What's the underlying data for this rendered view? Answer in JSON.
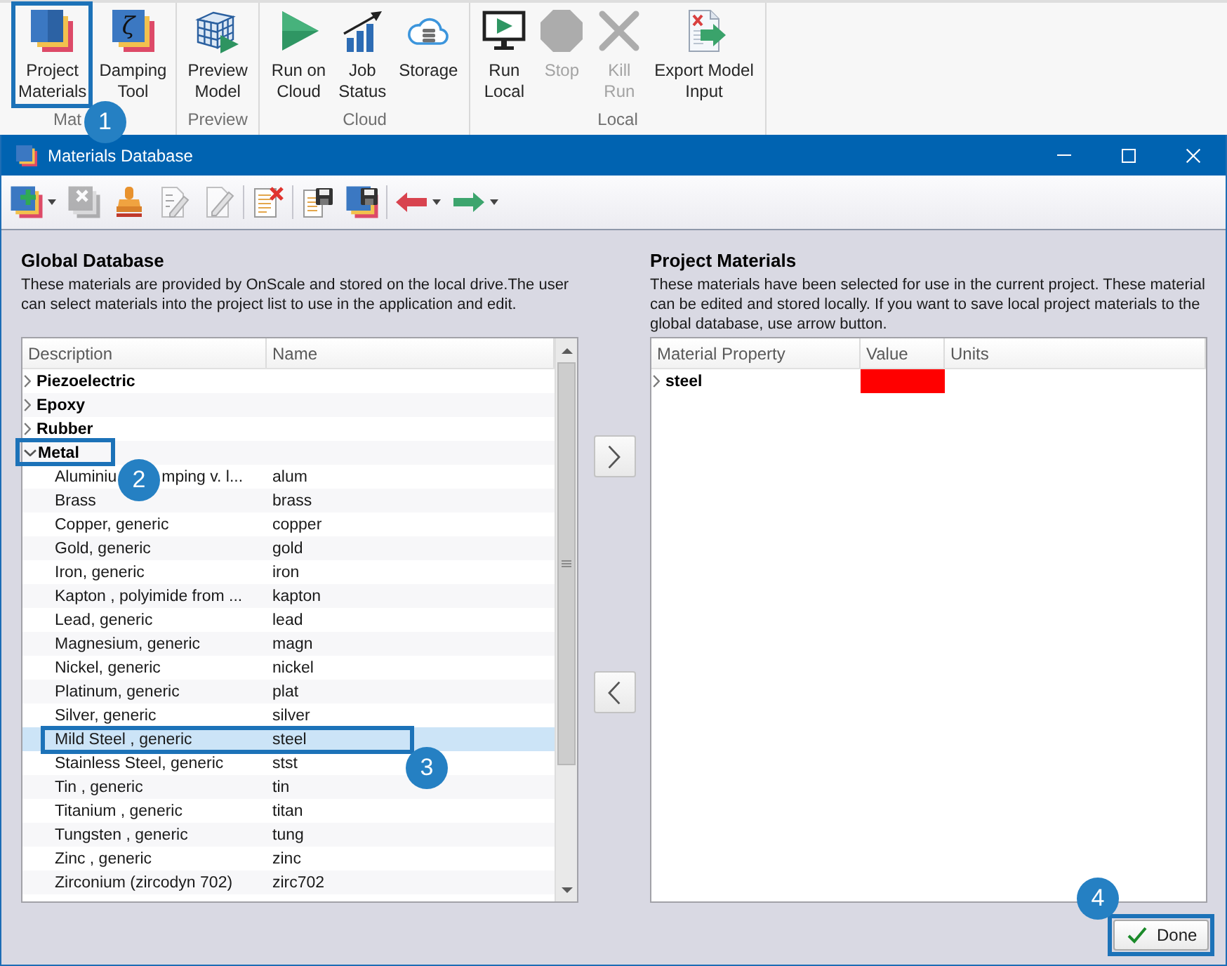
{
  "ribbon": {
    "groups": [
      {
        "label": "Mat",
        "buttons": [
          {
            "label": [
              "Project",
              "Materials"
            ],
            "disabled": false,
            "annotation": "1"
          },
          {
            "label": [
              "Damping",
              "Tool"
            ],
            "disabled": false,
            "icon_glyph": "ζ"
          }
        ]
      },
      {
        "label": "Preview",
        "buttons": [
          {
            "label": [
              "Preview",
              "Model"
            ],
            "disabled": false
          }
        ]
      },
      {
        "label": "Cloud",
        "buttons": [
          {
            "label": [
              "Run on",
              "Cloud"
            ],
            "disabled": false
          },
          {
            "label": [
              "Job",
              "Status"
            ],
            "disabled": false
          },
          {
            "label": [
              "Storage"
            ],
            "disabled": false
          }
        ]
      },
      {
        "label": "Local",
        "buttons": [
          {
            "label": [
              "Run",
              "Local"
            ],
            "disabled": false
          },
          {
            "label": [
              "Stop"
            ],
            "disabled": true
          },
          {
            "label": [
              "Kill",
              "Run"
            ],
            "disabled": true
          },
          {
            "label": [
              "Export Model",
              "Input"
            ],
            "disabled": false
          }
        ]
      }
    ]
  },
  "dialog": {
    "title": "Materials Database",
    "toolbar": [
      {
        "items": [
          {
            "disabled": false,
            "dropdown": true
          },
          {
            "disabled": true,
            "dropdown": false
          },
          {
            "disabled": false,
            "dropdown": false
          },
          {
            "disabled": true,
            "dropdown": false
          },
          {
            "disabled": true,
            "dropdown": false
          }
        ]
      },
      {
        "items": [
          {
            "disabled": false,
            "dropdown": false
          }
        ]
      },
      {
        "items": [
          {
            "disabled": false,
            "dropdown": false
          },
          {
            "disabled": false,
            "dropdown": false
          }
        ]
      },
      {
        "items": [
          {
            "disabled": false,
            "dropdown": true
          },
          {
            "disabled": false,
            "dropdown": true
          }
        ]
      }
    ]
  },
  "global_database": {
    "heading": "Global Database",
    "description": "These materials are provided by OnScale and stored on the local drive.The user can select materials into the project list to use in the application and edit.",
    "columns": [
      "Description",
      "Name"
    ],
    "rows": [
      {
        "description": "Piezoelectric",
        "expanded": false,
        "selected": false
      },
      {
        "description": "Epoxy",
        "expanded": false,
        "selected": false
      },
      {
        "description": "Rubber",
        "expanded": false,
        "selected": false
      },
      {
        "description": "Metal",
        "expanded": true,
        "selected": false,
        "annotation": "2",
        "children": [
          {
            "description_parts": [
              "Aluminiu",
              "mping v. l..."
            ],
            "name": "alum",
            "selected": false
          },
          {
            "description": "Brass",
            "name": "brass",
            "selected": false
          },
          {
            "description": "Copper, generic",
            "name": "copper",
            "selected": false
          },
          {
            "description": "Gold, generic",
            "name": "gold",
            "selected": false
          },
          {
            "description": "Iron, generic",
            "name": "iron",
            "selected": false
          },
          {
            "description": "Kapton , polyimide from ...",
            "name": "kapton",
            "selected": false
          },
          {
            "description": "Lead, generic",
            "name": "lead",
            "selected": false
          },
          {
            "description": "Magnesium, generic",
            "name": "magn",
            "selected": false
          },
          {
            "description": "Nickel, generic",
            "name": "nickel",
            "selected": false
          },
          {
            "description": "Platinum, generic",
            "name": "plat",
            "selected": false
          },
          {
            "description": "Silver, generic",
            "name": "silver",
            "selected": false
          },
          {
            "description": "Mild Steel , generic",
            "name": "steel",
            "selected": true,
            "annotation": "3"
          },
          {
            "description": "Stainless Steel, generic",
            "name": "stst",
            "selected": false
          },
          {
            "description": "Tin , generic",
            "name": "tin",
            "selected": false
          },
          {
            "description": "Titanium , generic",
            "name": "titan",
            "selected": false
          },
          {
            "description": "Tungsten , generic",
            "name": "tung",
            "selected": false
          },
          {
            "description": "Zinc , generic",
            "name": "zinc",
            "selected": false
          },
          {
            "description": "Zirconium (zircodyn 702)",
            "name": "zirc702",
            "selected": false
          }
        ]
      }
    ]
  },
  "project_materials": {
    "heading": "Project Materials",
    "description": "These materials have been selected for use in the current project. These material can be edited and stored locally. If you want to save local project materials to the global database, use arrow button.",
    "columns": [
      "Material Property",
      "Value",
      "Units"
    ],
    "rows": [
      {
        "property": "steel",
        "expanded": false,
        "selected": false,
        "color": "#ff0000"
      }
    ]
  },
  "done_button": {
    "label": "Done",
    "annotation": "4"
  }
}
